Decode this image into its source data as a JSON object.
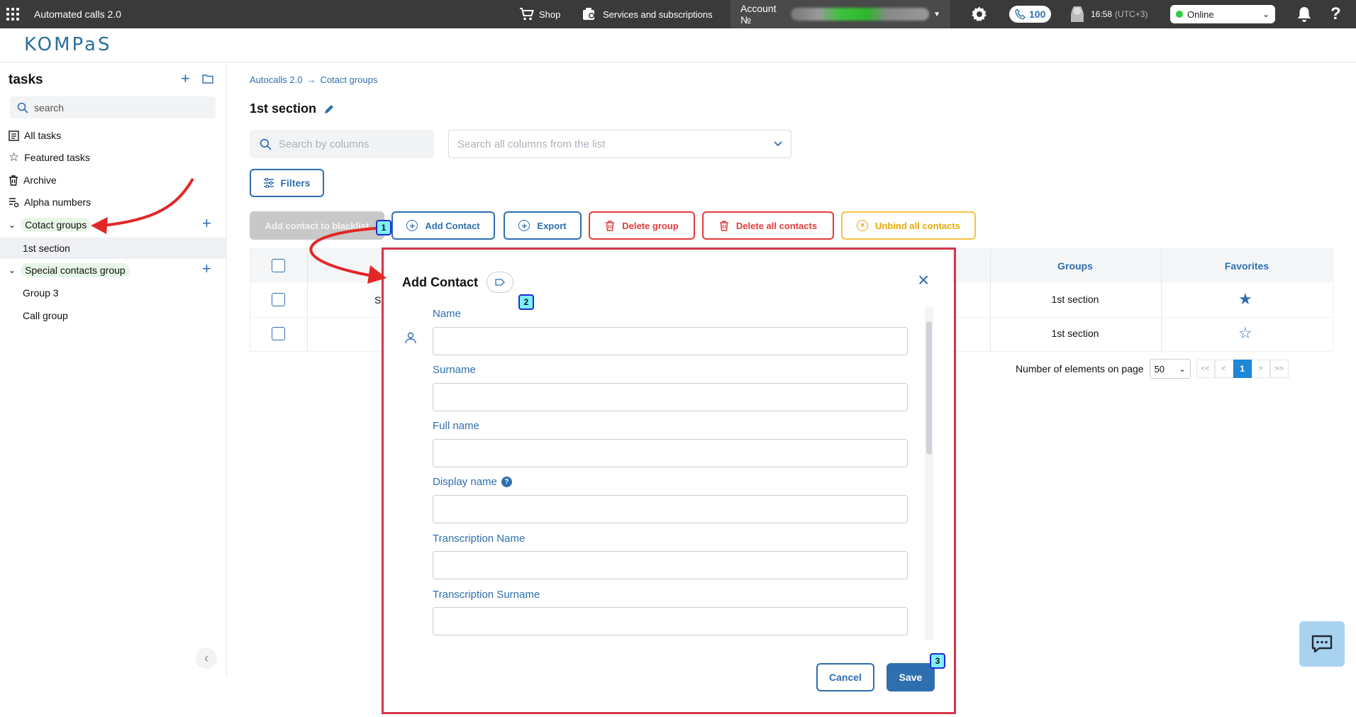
{
  "topbar": {
    "app_title": "Automated calls 2.0",
    "shop_label": "Shop",
    "services_label": "Services and subscriptions",
    "account_label": "Account №",
    "call_count": "100",
    "time": "16:58",
    "timezone": "(UTC+3)",
    "status": "Online"
  },
  "logo": "KOMPaS",
  "sidebar": {
    "title": "tasks",
    "search_placeholder": "search",
    "items": [
      {
        "label": "All tasks",
        "icon": "list-icon"
      },
      {
        "label": "Featured tasks",
        "icon": "star-icon"
      },
      {
        "label": "Archive",
        "icon": "trash-icon"
      },
      {
        "label": "Alpha numbers",
        "icon": "alpha-icon"
      }
    ],
    "group1": {
      "label": "Cotact groups",
      "children": [
        "1st section"
      ]
    },
    "group2": {
      "label": "Special contacts group",
      "children": [
        "Group 3",
        "Call group"
      ]
    }
  },
  "breadcrumb": {
    "root": "Autocalls 2.0",
    "current": "Cotact groups"
  },
  "page_title": "1st section",
  "search": {
    "columns_placeholder": "Search by columns",
    "list_placeholder": "Search all columns from the list"
  },
  "toolbar": {
    "filters": "Filters",
    "blacklist": "Add contact to blacklist",
    "add_contact": "Add Contact",
    "export": "Export",
    "delete_group": "Delete group",
    "delete_all": "Delete all contacts",
    "unbind_all": "Unbind all contacts"
  },
  "table": {
    "headers": {
      "groups": "Groups",
      "favorites": "Favorites"
    },
    "rows": [
      {
        "partial": "S",
        "group": "1st section",
        "favorite": true
      },
      {
        "partial": "",
        "group": "1st section",
        "favorite": false
      }
    ]
  },
  "pager": {
    "label": "Number of elements on page",
    "per_page": "50",
    "first": "<<",
    "prev": "<",
    "current": "1",
    "next": ">",
    "last": ">>"
  },
  "modal": {
    "title": "Add Contact",
    "fields": {
      "name": "Name",
      "surname": "Surname",
      "full_name": "Full name",
      "display_name": "Display name",
      "transcription_name": "Transcription Name",
      "transcription_surname": "Transcription Surname"
    },
    "cancel": "Cancel",
    "save": "Save"
  },
  "steps": [
    "1",
    "2",
    "3"
  ],
  "colors": {
    "primary": "#2f6fb0",
    "danger": "#e23b3b",
    "warning": "#e9a800",
    "highlight": "#d7334a",
    "online": "#2ecc40"
  }
}
